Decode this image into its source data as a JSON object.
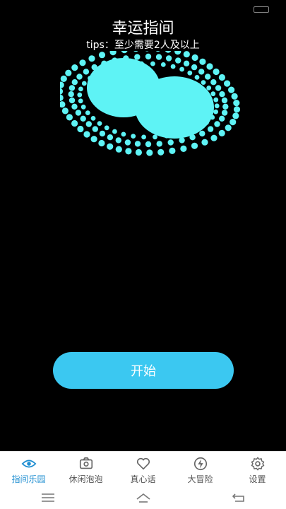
{
  "header": {
    "title": "幸运指间",
    "tips": "tips：至少需要2人及以上"
  },
  "main": {
    "start_label": "开始"
  },
  "colors": {
    "accent": "#3bc8f1",
    "finger": "#5ef3f5",
    "tab_active": "#1f8ed1",
    "tab_inactive": "#555555"
  },
  "tabs": [
    {
      "label": "指间乐园",
      "icon": "eye-icon",
      "active": true
    },
    {
      "label": "休闲泡泡",
      "icon": "camera-icon",
      "active": false
    },
    {
      "label": "真心话",
      "icon": "heart-icon",
      "active": false
    },
    {
      "label": "大冒险",
      "icon": "lightning-icon",
      "active": false
    },
    {
      "label": "设置",
      "icon": "gear-icon",
      "active": false
    }
  ],
  "system_nav": {
    "icons": [
      "menu-icon",
      "home-icon",
      "back-icon"
    ]
  }
}
